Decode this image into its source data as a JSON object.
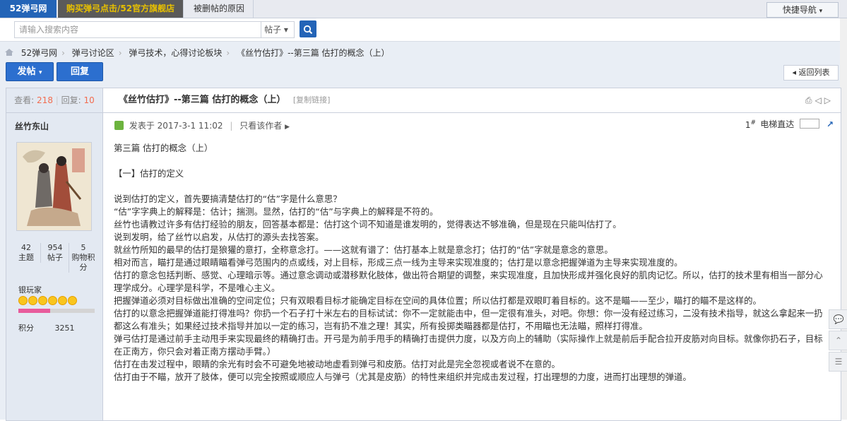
{
  "topbar": {
    "logo": "52弹弓网",
    "links": [
      "购买弹弓点击/52官方旗舰店",
      "被删帖的原因"
    ],
    "quicknav": "快捷导航"
  },
  "search": {
    "placeholder": "请输入搜索内容",
    "type": "帖子",
    "button": "search-icon"
  },
  "breadcrumb": [
    "52弹弓网",
    "弹弓讨论区",
    "弹弓技术，心得讨论板块",
    "《丝竹估打》--第三篇 估打的概念（上）"
  ],
  "actions": {
    "post": "发帖",
    "reply": "回复",
    "back": "返回列表"
  },
  "thread": {
    "views_label": "查看:",
    "views": "218",
    "replies_label": "回复:",
    "replies": "10",
    "title": "《丝竹估打》--第三篇 估打的概念（上）",
    "copy_link": "[复制链接]"
  },
  "author": {
    "name": "丝竹东山",
    "topics": "42",
    "topics_label": "主题",
    "posts": "954",
    "posts_label": "帖子",
    "credits": "5",
    "credits_label": "购物积分",
    "rank": "银玩家",
    "star_count": 6,
    "progress_fraction": 0.42,
    "points_label": "积分",
    "points": "3251"
  },
  "post": {
    "posted_at": "发表于 2017-3-1 11:02",
    "only_author": "只看该作者",
    "floor": "1",
    "floor_suffix": "#",
    "jump_label": "电梯直达",
    "lines": [
      "第三篇 估打的概念（上）",
      "",
      "【一】估打的定义",
      "",
      "说到估打的定义，首先要搞清楚估打的“估”字是什么意思？",
      "“估”字字典上的解释是：估计；揣测。显然，估打的“估”与字典上的解释是不符的。",
      "丝竹也请教过许多有估打经验的朋友，回答基本都是：估打这个词不知道是谁发明的，觉得表达不够准确，但是现在只能叫估打了。",
      "说到发明，给了丝竹以启发，从估打的源头去找答案。",
      "就丝竹所知的最早的估打是狼獾的意打，全称意念打。——这就有谱了：估打基本上就是意念打；估打的“估”字就是意念的意思。",
      "相对而言，瞄打是通过眼睛瞄看弹弓范围内的点或线，对上目标，形成三点一线为主导来实现准度的；估打是以意念把握弹道为主导来实现准度的。",
      "估打的意念包括判断、感觉、心理暗示等。通过意念调动或潜移默化肢体，做出符合期望的调整，来实现准度，且加快形成并强化良好的肌肉记忆。所以，估打的技术里有相当一部分心理学成分。心理学是科学，不是唯心主义。",
      "把握弹道必须对目标做出准确的空间定位；只有双眼看目标才能确定目标在空间的具体位置；所以估打都是双眼盯着目标的。这不是瞄——至少，瞄打的瞄不是这样的。",
      "估打的以意念把握弹道能打得准吗？你扔一个石子打十米左右的目标试试：你不一定就能击中，但一定很有准头，对吧。你想：你一没有经过练习，二没有技术指导，就这么拿起来一扔都这么有准头；如果经过技术指导并加以一定的练习，岂有扔不准之理！其实，所有投掷类瞄器都是估打，不用瞄也无法瞄，照样打得准。",
      "弹弓估打是通过前手主动甩手来实现最终的精确打击。开弓是为前手甩手的精确打击提供力度，以及方向上的辅助（实际操作上就是前后手配合拉开皮筋对向目标。就像你扔石子，目标在正南方，你只会对着正南方摆动手臂。）",
      "估打在击发过程中，眼睛的余光有时会不可避免地被动地虚看到弹弓和皮筋。估打对此是完全忽视或者说不在意的。",
      "估打由于不瞄，放开了肢体，便可以完全按照或顺应人与弹弓（尤其是皮筋）的特性来组织并完成击发过程，打出理想的力度，进而打出理想的弹道。"
    ]
  }
}
